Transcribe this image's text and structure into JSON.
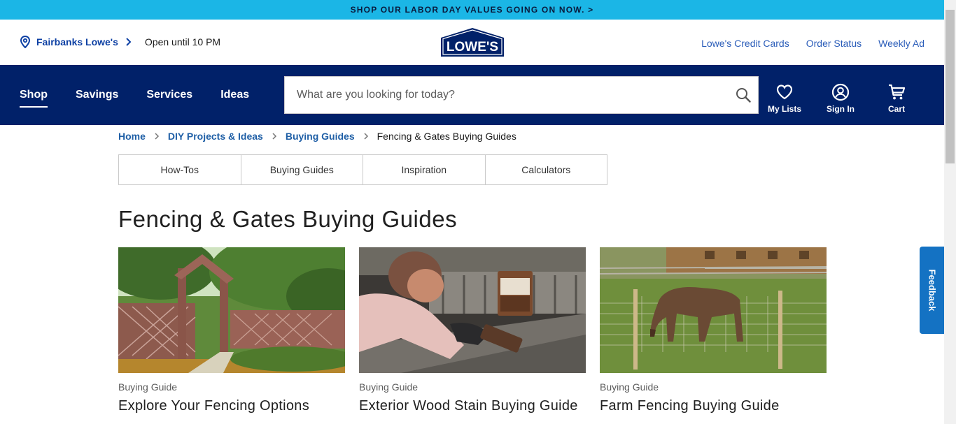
{
  "promo": {
    "text": "SHOP OUR LABOR DAY VALUES GOING ON NOW. >"
  },
  "utility": {
    "store_name": "Fairbanks Lowe's",
    "hours": "Open until 10 PM",
    "logo_text": "LOWE'S",
    "links": [
      "Lowe's Credit Cards",
      "Order Status",
      "Weekly Ad"
    ]
  },
  "nav": {
    "links": [
      "Shop",
      "Savings",
      "Services",
      "Ideas"
    ],
    "active": "Shop",
    "search_placeholder": "What are you looking for today?",
    "icons": [
      {
        "label": "My Lists",
        "icon": "heart-icon"
      },
      {
        "label": "Sign In",
        "icon": "user-icon"
      },
      {
        "label": "Cart",
        "icon": "cart-icon"
      }
    ]
  },
  "breadcrumb": {
    "items": [
      "Home",
      "DIY Projects & Ideas",
      "Buying Guides"
    ],
    "current": "Fencing & Gates Buying Guides"
  },
  "tabs": [
    "How-Tos",
    "Buying Guides",
    "Inspiration",
    "Calculators"
  ],
  "page_title": "Fencing & Gates Buying Guides",
  "cards": [
    {
      "kicker": "Buying Guide",
      "title": "Explore Your Fencing Options",
      "image": "lattice fence and arbor"
    },
    {
      "kicker": "Buying Guide",
      "title": "Exterior Wood Stain Buying Guide",
      "image": "woman staining deck"
    },
    {
      "kicker": "Buying Guide",
      "title": "Farm Fencing Buying Guide",
      "image": "horse behind wire fence"
    }
  ],
  "feedback": "Feedback",
  "colors": {
    "promo": "#1bb6e6",
    "nav": "#012169",
    "link": "#1f5fa6",
    "feedback": "#1472c3"
  }
}
